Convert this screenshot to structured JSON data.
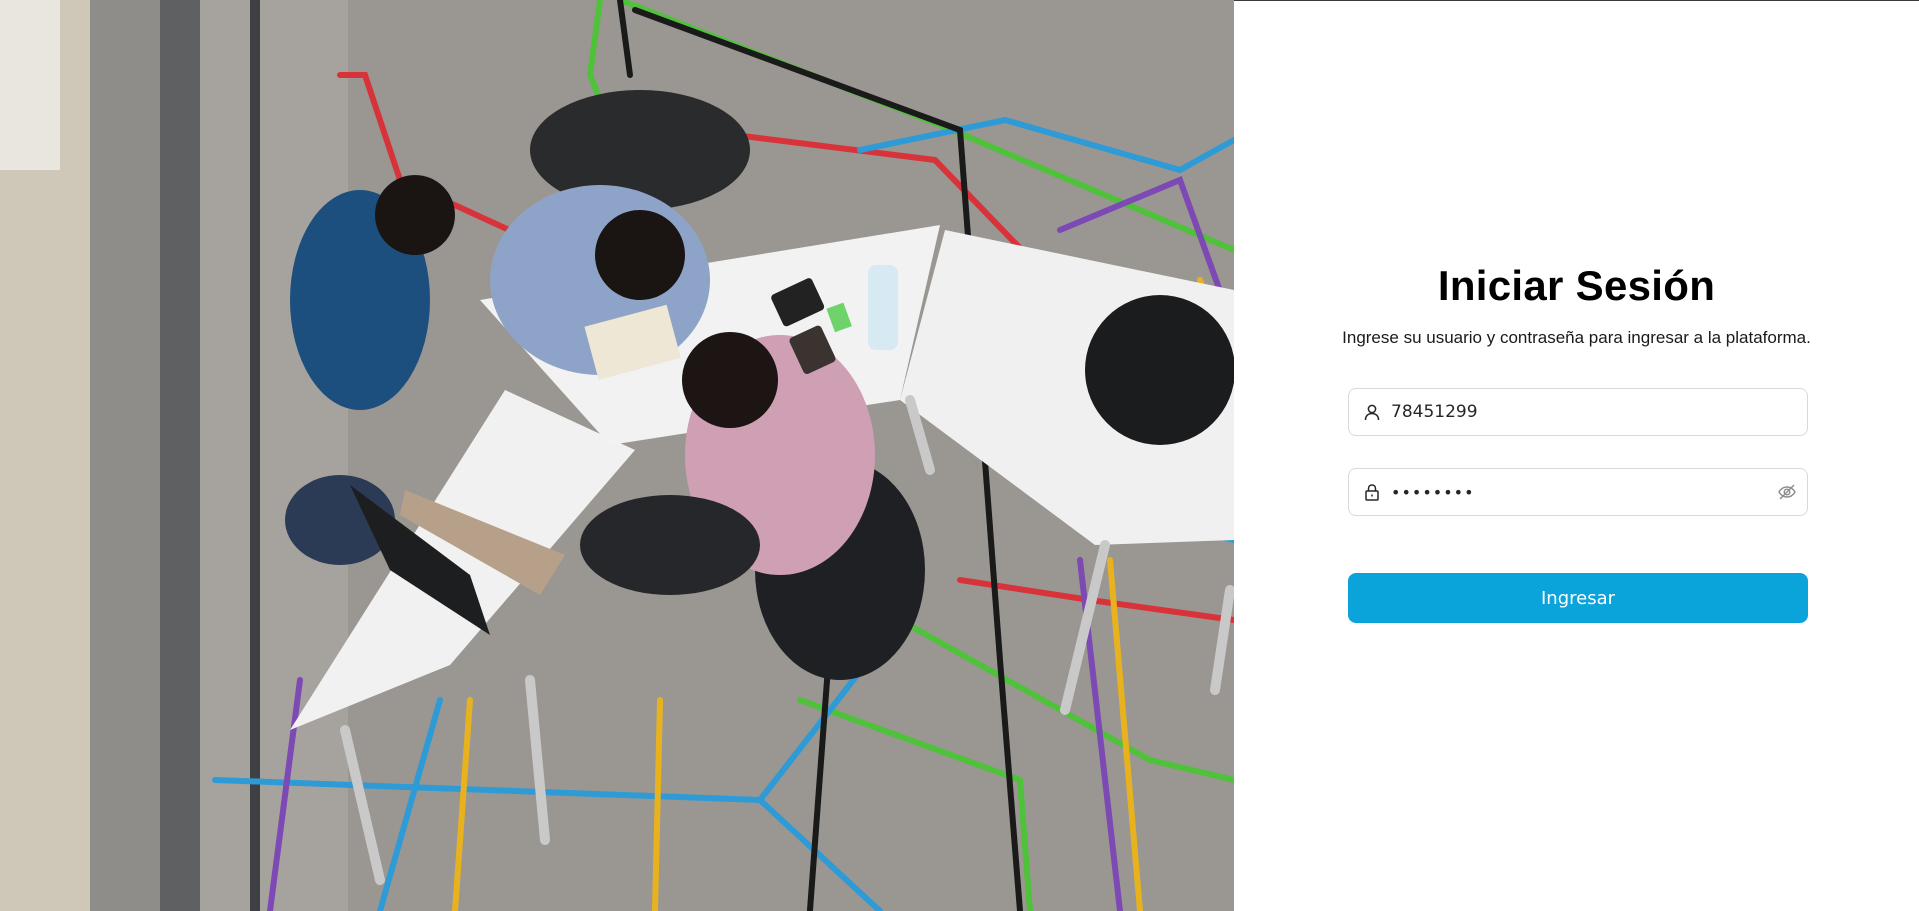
{
  "hero": {
    "image": "four-men-working-at-white-tables-with-laptop-top-view"
  },
  "login": {
    "title": "Iniciar Sesión",
    "subtitle": "Ingrese su usuario y contraseña para ingresar a la plataforma.",
    "username": {
      "value": "78451299",
      "icon": "user-icon"
    },
    "password": {
      "value": "••••••••",
      "icon": "lock-icon",
      "toggle_icon": "eye-invisible-icon"
    },
    "submit_label": "Ingresar"
  },
  "colors": {
    "primary_button": "#0aa3da",
    "input_border": "#d9d9d9",
    "title": "#000000"
  }
}
